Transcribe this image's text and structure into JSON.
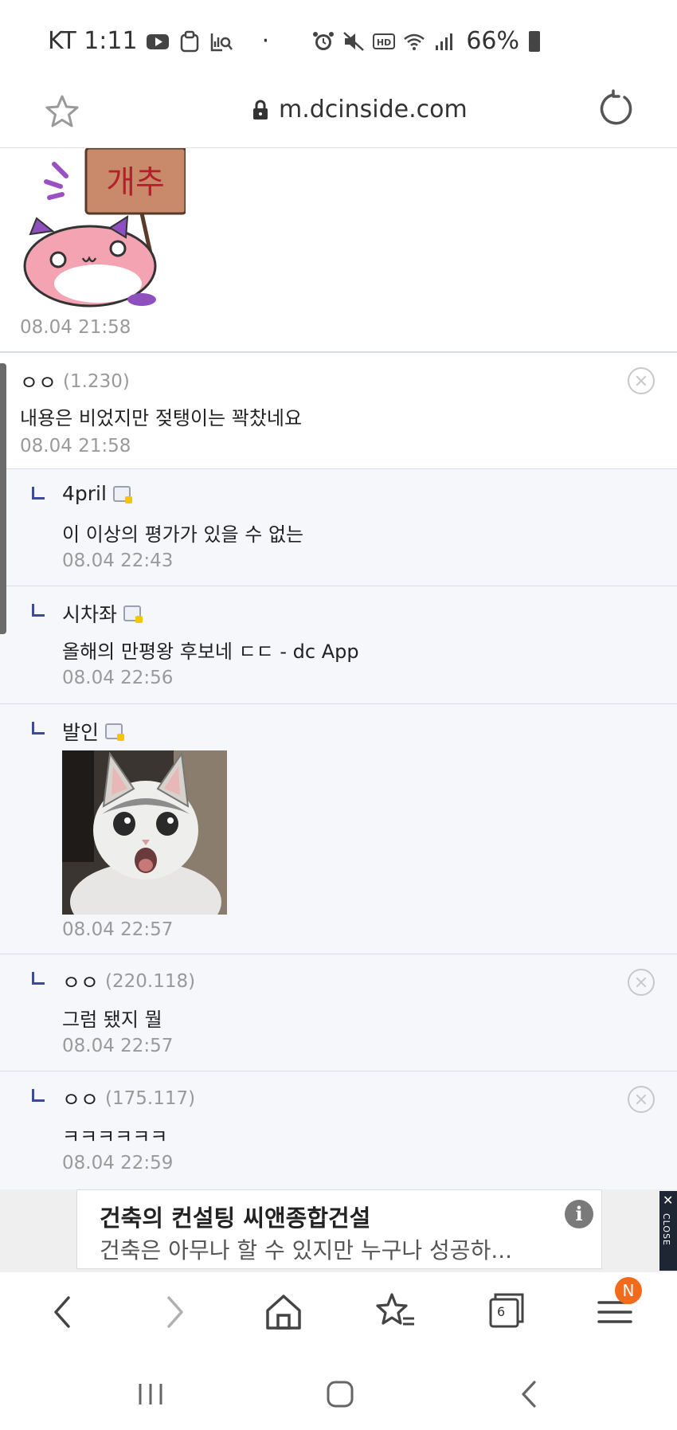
{
  "status_bar": {
    "carrier_time": "KT 1:11",
    "dot": "·",
    "battery_percent": "66%",
    "left_icons": [
      "youtube-icon",
      "clipboard-icon",
      "gallery-search-icon"
    ],
    "right_icons": [
      "alarm-icon",
      "mute-icon",
      "hd-icon",
      "wifi-icon",
      "signal-icon",
      "battery-icon"
    ]
  },
  "browser": {
    "url": "m.dcinside.com"
  },
  "comments": [
    {
      "type": "sticker",
      "sticker_text": "개추",
      "time": "08.04 21:58"
    },
    {
      "type": "comment",
      "nick": "ㅇㅇ",
      "ip": "(1.230)",
      "text": "내용은 비었지만 젖탱이는 꽉찼네요",
      "time": "08.04 21:58",
      "deletable": true
    },
    {
      "type": "reply",
      "nick": "4pril",
      "text": "이 이상의 평가가 있을 수 없는",
      "time": "08.04 22:43"
    },
    {
      "type": "reply",
      "nick": "시차좌",
      "text": "올해의 만평왕 후보네 ㄷㄷ - dc App",
      "time": "08.04 22:56"
    },
    {
      "type": "reply-image",
      "nick": "발인",
      "time": "08.04 22:57"
    },
    {
      "type": "reply",
      "nick": "ㅇㅇ",
      "ip": "(220.118)",
      "text": "그럼 됐지 뭘",
      "time": "08.04 22:57",
      "deletable": true
    },
    {
      "type": "reply",
      "nick": "ㅇㅇ",
      "ip": "(175.117)",
      "text": "ㅋㅋㅋㅋㅋㅋ",
      "time": "08.04 22:59",
      "deletable": true
    }
  ],
  "ad": {
    "title": "건축의 컨설팅 씨앤종합건설",
    "description": "건축은 아무나 할 수 있지만 누구나 성공하...",
    "info_label": "i",
    "close_x": "✕",
    "close_label": "CLOSE"
  },
  "toolbar": {
    "tab_count": "6",
    "menu_badge": "N"
  },
  "colors": {
    "reply_background": "#f6f7fb",
    "reply_marker": "#3d4a99",
    "timestamp": "#9a9a9a",
    "badge_orange": "#f26a1b",
    "ad_close_bg": "#1e2533"
  }
}
